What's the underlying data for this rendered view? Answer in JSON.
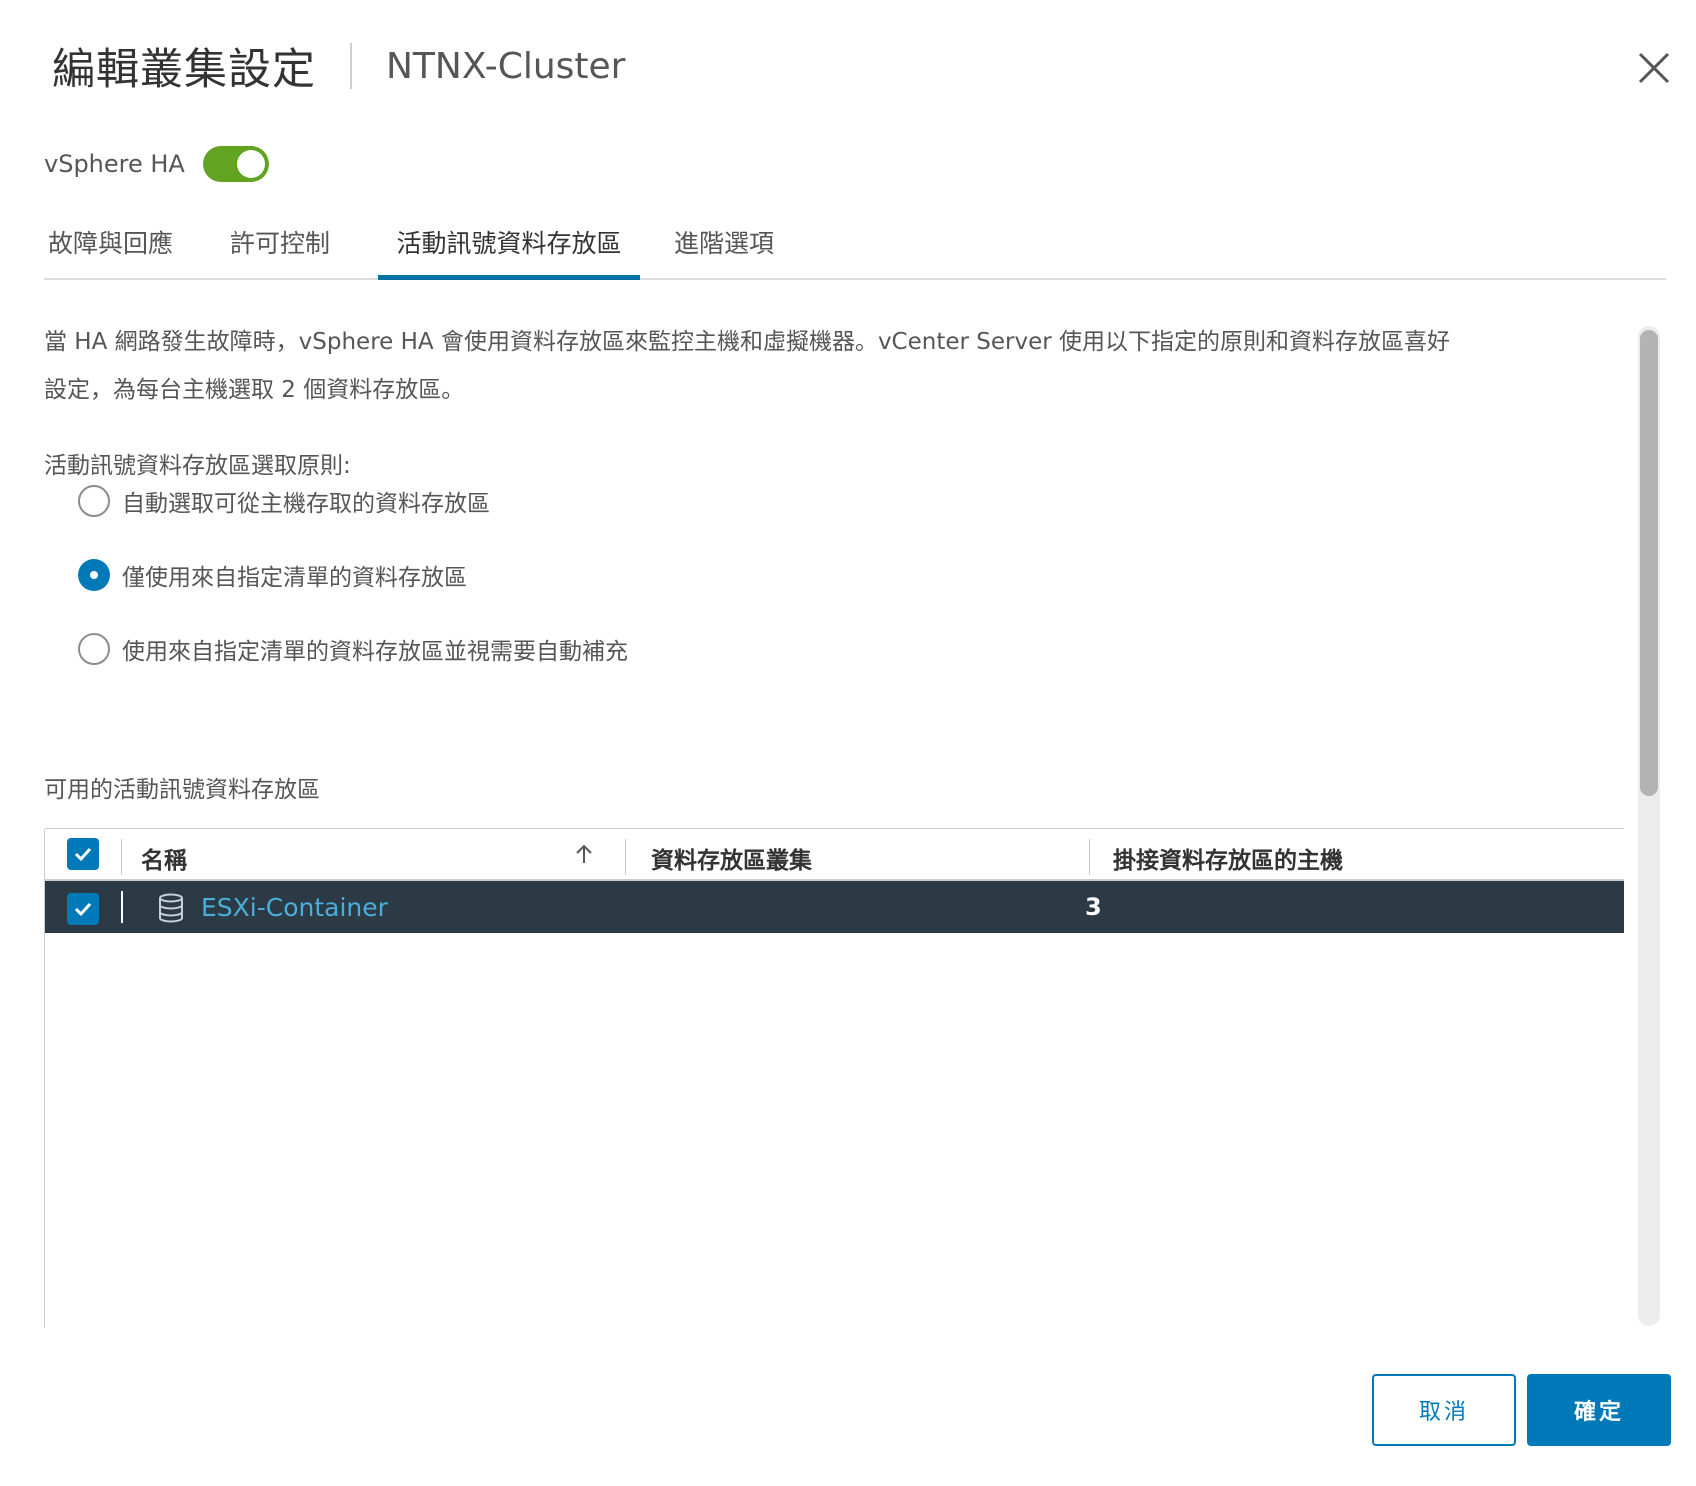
{
  "dialog": {
    "title": "編輯叢集設定",
    "subtitle": "NTNX-Cluster"
  },
  "ha": {
    "label": "vSphere HA",
    "enabled": true
  },
  "tabs": [
    {
      "label": "故障與回應",
      "active": false
    },
    {
      "label": "許可控制",
      "active": false
    },
    {
      "label": "活動訊號資料存放區",
      "active": true
    },
    {
      "label": "進階選項",
      "active": false
    }
  ],
  "content": {
    "description_line1": "當 HA 網路發生故障時，vSphere HA 會使用資料存放區來監控主機和虛擬機器。vCenter Server 使用以下指定的原則和資料存放區喜好",
    "description_line2": "設定，為每台主機選取 2 個資料存放區。",
    "policy_label": "活動訊號資料存放區選取原則:",
    "options": [
      {
        "label": "自動選取可從主機存取的資料存放區",
        "selected": false
      },
      {
        "label": "僅使用來自指定清單的資料存放區",
        "selected": true
      },
      {
        "label": "使用來自指定清單的資料存放區並視需要自動補充",
        "selected": false
      }
    ],
    "available_label": "可用的活動訊號資料存放區"
  },
  "grid": {
    "columns": [
      "名稱",
      "資料存放區叢集",
      "掛接資料存放區的主機"
    ],
    "rows": [
      {
        "name": "ESXi-Container",
        "cluster": "",
        "hosts": "3",
        "checked": true,
        "selected": true
      }
    ]
  },
  "footer": {
    "cancel_label": "取消",
    "ok_label": "確定"
  },
  "colors": {
    "accent": "#0079b8",
    "toggle_on": "#62a420",
    "selected_row": "#2c3a46",
    "link": "#49afd9"
  }
}
